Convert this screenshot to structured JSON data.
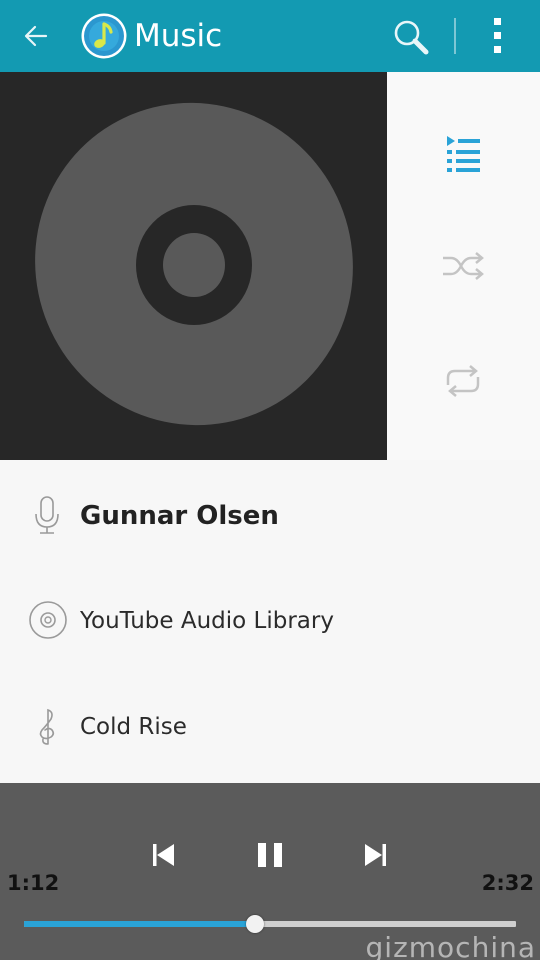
{
  "app_bar": {
    "title": "Music",
    "back_icon": "arrow-left-icon",
    "app_icon": "music-note-icon",
    "search_icon": "search-icon",
    "overflow_icon": "more-vert-icon",
    "background": "#139ab2"
  },
  "side_controls": {
    "playlist_icon": "playlist-icon",
    "shuffle_icon": "shuffle-icon",
    "repeat_icon": "repeat-icon",
    "active_color": "#2aa3d7"
  },
  "track": {
    "artist": "Gunnar Olsen",
    "album": "YouTube Audio Library",
    "title": "Cold Rise"
  },
  "player": {
    "elapsed": "1:12",
    "duration": "2:32",
    "progress_fraction": 0.47,
    "watermark": "gizmochina"
  }
}
